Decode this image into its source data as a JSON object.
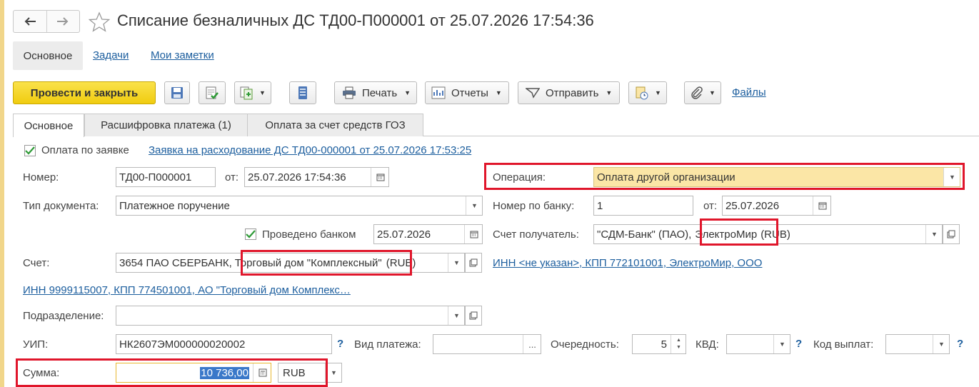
{
  "window": {
    "title": "Списание безналичных ДС ТД00-П000001 от 25.07.2026 17:54:36"
  },
  "topnav": {
    "items": [
      "Основное",
      "Задачи",
      "Мои заметки"
    ]
  },
  "toolbar": {
    "post_close": "Провести и закрыть",
    "print": "Печать",
    "reports": "Отчеты",
    "send": "Отправить",
    "files": "Файлы"
  },
  "tabs": [
    "Основное",
    "Расшифровка платежа (1)",
    "Оплата за счет средств ГОЗ"
  ],
  "form": {
    "payment_by_request_label": "Оплата по заявке",
    "request_link": "Заявка на расходование ДС ТД00-000001 от 25.07.2026 17:53:25",
    "number_label": "Номер:",
    "number_value": "ТД00-П000001",
    "from_label": "от:",
    "date_value": "25.07.2026 17:54:36",
    "operation_label": "Операция:",
    "operation_value": "Оплата другой организации",
    "doc_type_label": "Тип документа:",
    "doc_type_value": "Платежное поручение",
    "bank_number_label": "Номер по банку:",
    "bank_number_value": "1",
    "bank_date_label": "от:",
    "bank_date_value": "25.07.2026",
    "bank_posted_label": "Проведено банком",
    "bank_posted_date": "25.07.2026",
    "recipient_account_label": "Счет получатель:",
    "recipient_account_prefix": "\"СДМ-Банк\" (ПАО),",
    "recipient_account_mid": "ЭлектроМир",
    "recipient_account_suffix": "(RUB)",
    "account_label": "Счет:",
    "account_prefix": "3654 ПАО СБЕРБАНК,",
    "account_mid": "Торговый дом \"Комплексный\"",
    "account_suffix": "(RUB)",
    "recipient_inn_link": "ИНН <не указан>, КПП 772101001, ЭлектроМир, ООО",
    "org_inn_link": "ИНН 9999115007, КПП 774501001, АО \"Торговый дом Комплекс…",
    "division_label": "Подразделение:",
    "division_value": "",
    "uip_label": "УИП:",
    "uip_value": "НК2607ЭМ000000020002",
    "payment_kind_label": "Вид платежа:",
    "payment_kind_value": "",
    "payment_kind_btn": "...",
    "priority_label": "Очередность:",
    "priority_value": "5",
    "kvd_label": "КВД:",
    "kvd_value": "",
    "payout_code_label": "Код выплат:",
    "payout_code_value": "",
    "amount_label": "Сумма:",
    "amount_value": "10 736,00",
    "currency_value": "RUB",
    "help_mark": "?"
  },
  "colors": {
    "accent_yellow": "#f5d31f",
    "highlight_red": "#e0162b",
    "link_blue": "#1c5e9e",
    "operation_bg": "#fbe6a6",
    "selection_blue": "#3a78c9"
  }
}
